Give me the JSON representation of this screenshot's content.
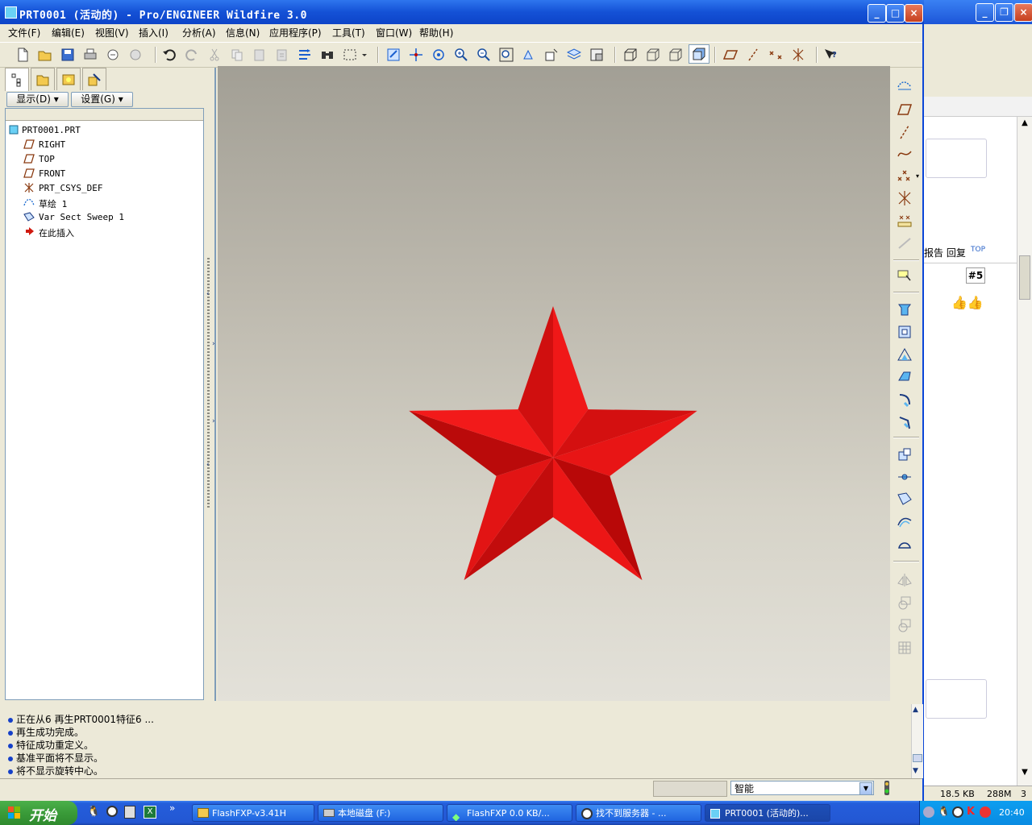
{
  "window": {
    "title": "PRT0001 (活动的) - Pro/ENGINEER Wildfire 3.0"
  },
  "menu": [
    "文件(F)",
    "编辑(E)",
    "视图(V)",
    "插入(I)",
    "分析(A)",
    "信息(N)",
    "应用程序(P)",
    "工具(T)",
    "窗口(W)",
    "帮助(H)"
  ],
  "left_panel": {
    "show_button": "显示(D)",
    "settings_button": "设置(G)",
    "tree": [
      {
        "label": "PRT0001.PRT",
        "icon": "part-icon"
      },
      {
        "label": "RIGHT",
        "icon": "datum-plane-icon"
      },
      {
        "label": "TOP",
        "icon": "datum-plane-icon"
      },
      {
        "label": "FRONT",
        "icon": "datum-plane-icon"
      },
      {
        "label": "PRT_CSYS_DEF",
        "icon": "csys-icon"
      },
      {
        "label": "草绘 1",
        "icon": "sketch-icon"
      },
      {
        "label": "Var Sect Sweep 1",
        "icon": "sweep-icon"
      },
      {
        "label": "在此插入",
        "icon": "insert-arrow-icon"
      }
    ]
  },
  "viewport": {
    "model": "red-star-3d",
    "star_color": "#e31414"
  },
  "messages": [
    "正在从6 再生PRT0001特征6 ...",
    "再生成功完成。",
    "特征成功重定义。",
    "基准平面将不显示。",
    "将不显示旋转中心。"
  ],
  "status": {
    "filter": "智能"
  },
  "background_window": {
    "reply_text": "报告 回复",
    "post_number": "#5",
    "file_size": "18.5 KB",
    "memory": "288M",
    "extra": "3"
  },
  "taskbar": {
    "start": "开始",
    "tasks": [
      "FlashFXP-v3.41H",
      "本地磁盘 (F:)",
      "FlashFXP 0.0 KB/...",
      "找不到服务器 - ...",
      "PRT0001 (活动的)..."
    ],
    "clock": "20:40"
  }
}
